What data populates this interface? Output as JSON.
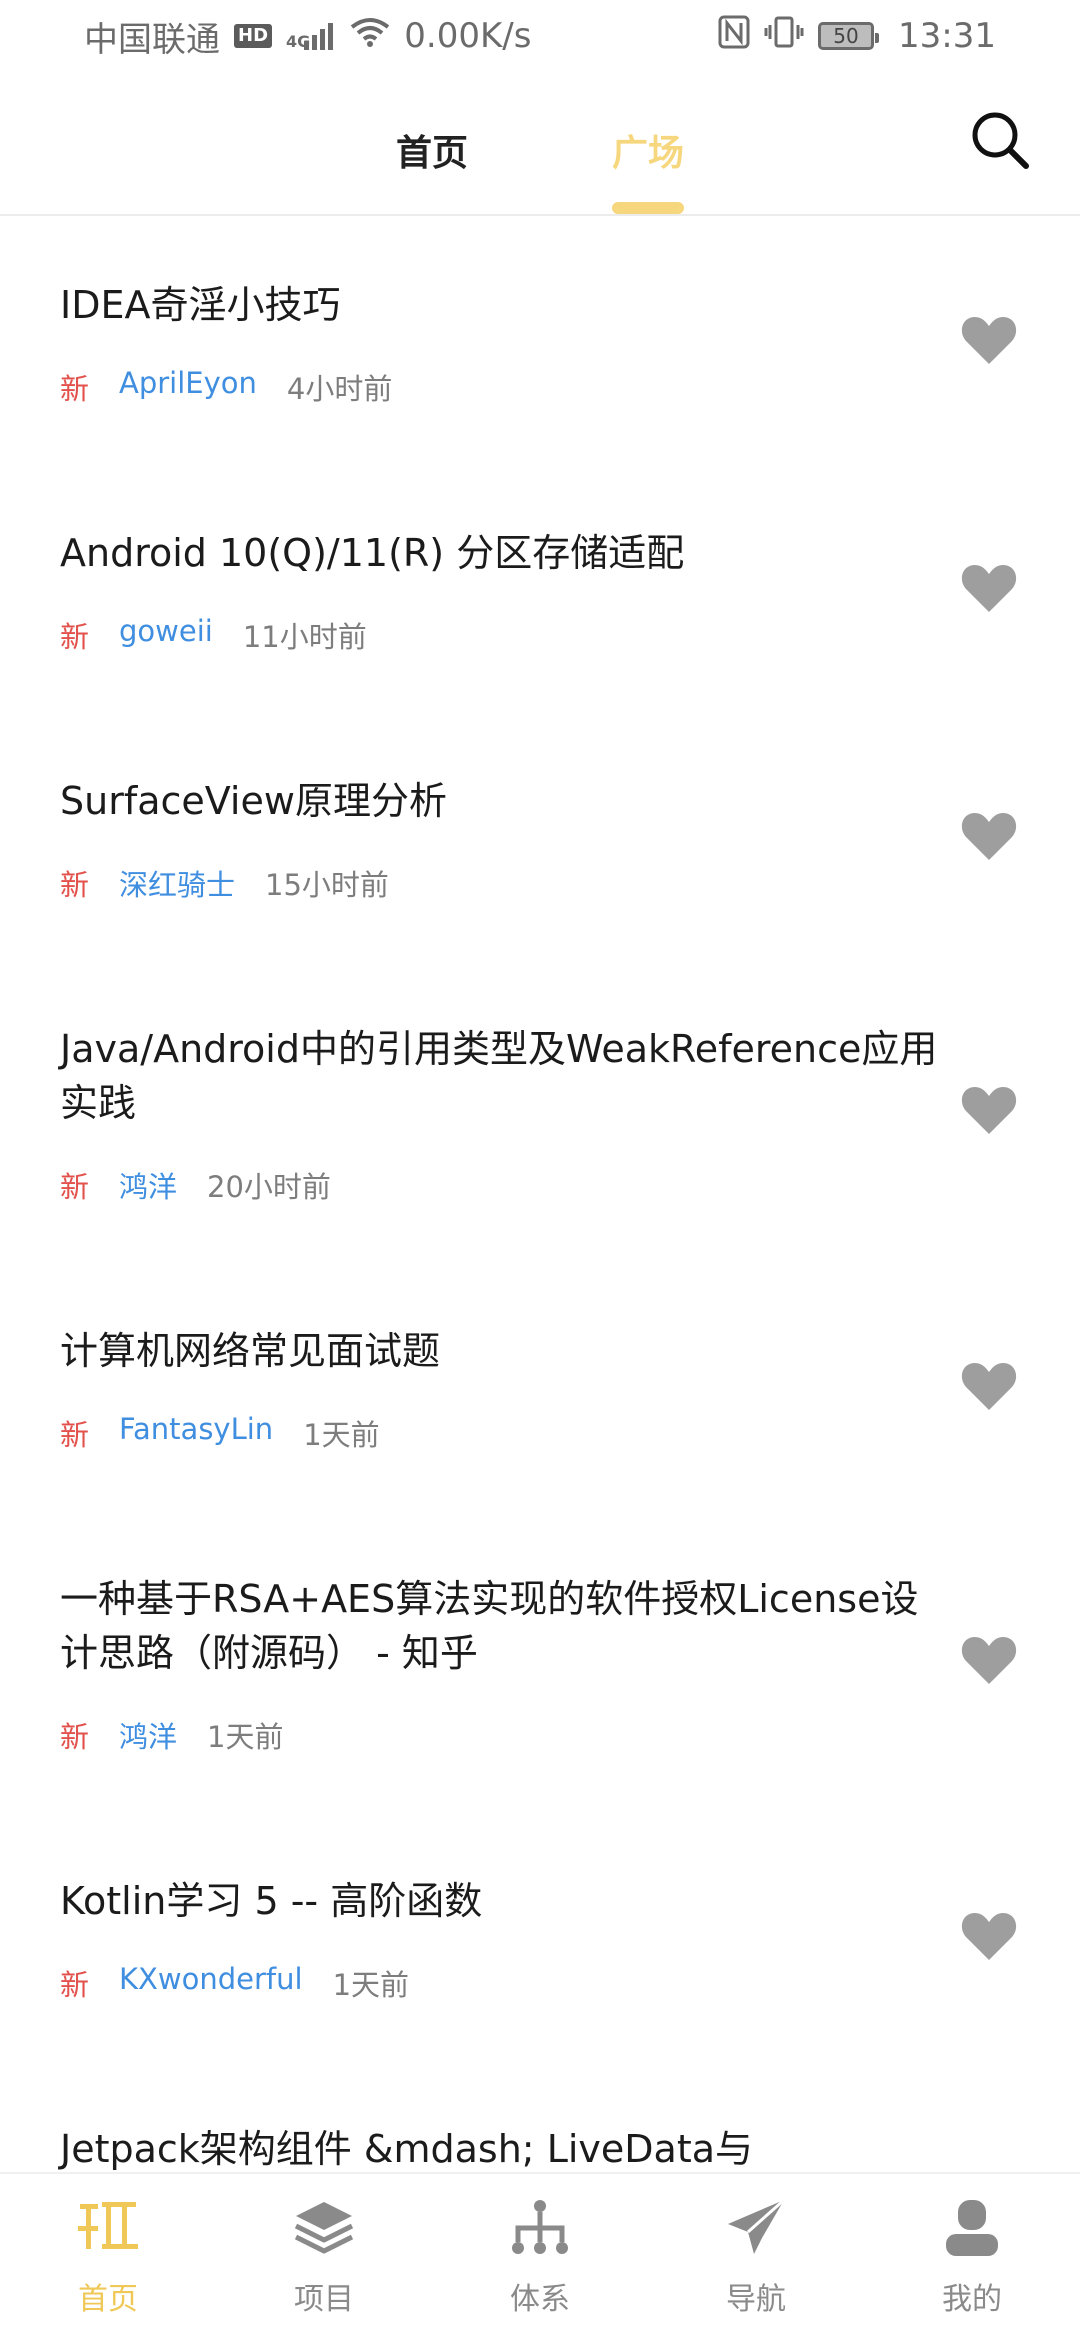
{
  "status_bar": {
    "carrier": "中国联通",
    "hd": "HD",
    "network": "4G",
    "speed": "0.00K/s",
    "battery": "50",
    "time": "13:31"
  },
  "top_tabs": {
    "home": "首页",
    "square": "广场"
  },
  "colors": {
    "accent": "#f7d77e",
    "new_tag": "#e2514c",
    "author": "#3f8ee0",
    "heart": "#9e9e9e"
  },
  "articles": [
    {
      "title": "IDEA奇淫小技巧",
      "tag": "新",
      "author": "AprilEyon",
      "time": "4小时前"
    },
    {
      "title": "Android 10(Q)/11(R) 分区存储适配",
      "tag": "新",
      "author": "goweii",
      "time": "11小时前"
    },
    {
      "title": "SurfaceView原理分析",
      "tag": "新",
      "author": "深红骑士",
      "time": "15小时前"
    },
    {
      "title": "Java/Android中的引用类型及WeakReference应用实践",
      "tag": "新",
      "author": "鸿洋",
      "time": "20小时前"
    },
    {
      "title": "计算机网络常见面试题",
      "tag": "新",
      "author": "FantasyLin",
      "time": "1天前"
    },
    {
      "title": "一种基于RSA+AES算法实现的软件授权License设计思路（附源码） - 知乎",
      "tag": "新",
      "author": "鸿洋",
      "time": "1天前"
    },
    {
      "title": "Kotlin学习 5 -- 高阶函数",
      "tag": "新",
      "author": "KXwonderful",
      "time": "1天前"
    },
    {
      "title": "Jetpack架构组件 &mdash; LiveData与"
    }
  ],
  "bottom_nav": [
    {
      "label": "首页",
      "icon": "play-icon"
    },
    {
      "label": "项目",
      "icon": "layers-icon"
    },
    {
      "label": "体系",
      "icon": "hierarchy-icon"
    },
    {
      "label": "导航",
      "icon": "paper-plane-icon"
    },
    {
      "label": "我的",
      "icon": "user-icon"
    }
  ]
}
